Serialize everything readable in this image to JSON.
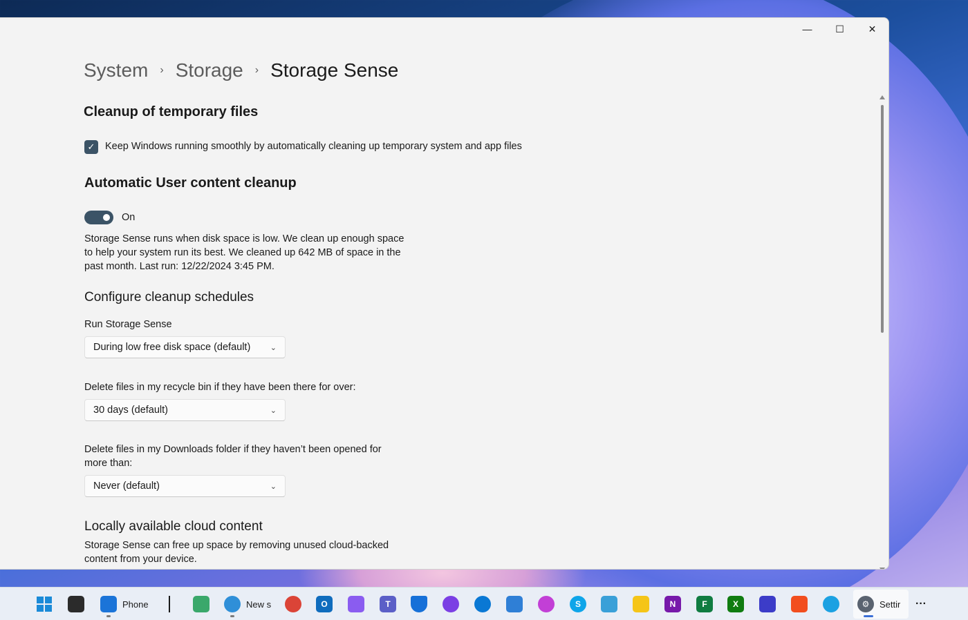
{
  "window": {
    "controls": {
      "minimize": "—",
      "maximize": "☐",
      "close": "✕"
    }
  },
  "breadcrumb": {
    "items": [
      "System",
      "Storage",
      "Storage Sense"
    ],
    "separator": "›"
  },
  "temp_files": {
    "heading": "Cleanup of temporary files",
    "checkbox_label": "Keep Windows running smoothly by automatically cleaning up temporary system and app files",
    "checked": true
  },
  "auto_cleanup": {
    "heading": "Automatic User content cleanup",
    "toggle_label": "On",
    "toggle_on": true,
    "description_lines": [
      "Storage Sense runs when disk space is low. We clean up enough space",
      "to help your system run its best. We cleaned up 642 MB of space in the",
      "past month. Last run: 12/22/2024 3:45 PM."
    ]
  },
  "schedules": {
    "heading": "Configure cleanup schedules",
    "run_label": "Run Storage Sense",
    "run_value": "During low free disk space (default)",
    "recycle_label": "Delete files in my recycle bin if they have been there for over:",
    "recycle_value": "30 days (default)",
    "downloads_label_lines": [
      "Delete files in my Downloads folder if they haven’t been opened for",
      "more than:"
    ],
    "downloads_value": "Never (default)"
  },
  "cloud": {
    "heading": "Locally available cloud content",
    "description_lines": [
      "Storage Sense can free up space by removing unused cloud-backed",
      "content from your device."
    ]
  },
  "taskbar": {
    "phone_label": "Phone",
    "news_label": "New s",
    "settings_label": "Settir",
    "more": "···"
  },
  "colors": {
    "accent": "#3b5366",
    "window_bg": "#f3f3f3",
    "taskbar_bg": "#e9eef6"
  }
}
